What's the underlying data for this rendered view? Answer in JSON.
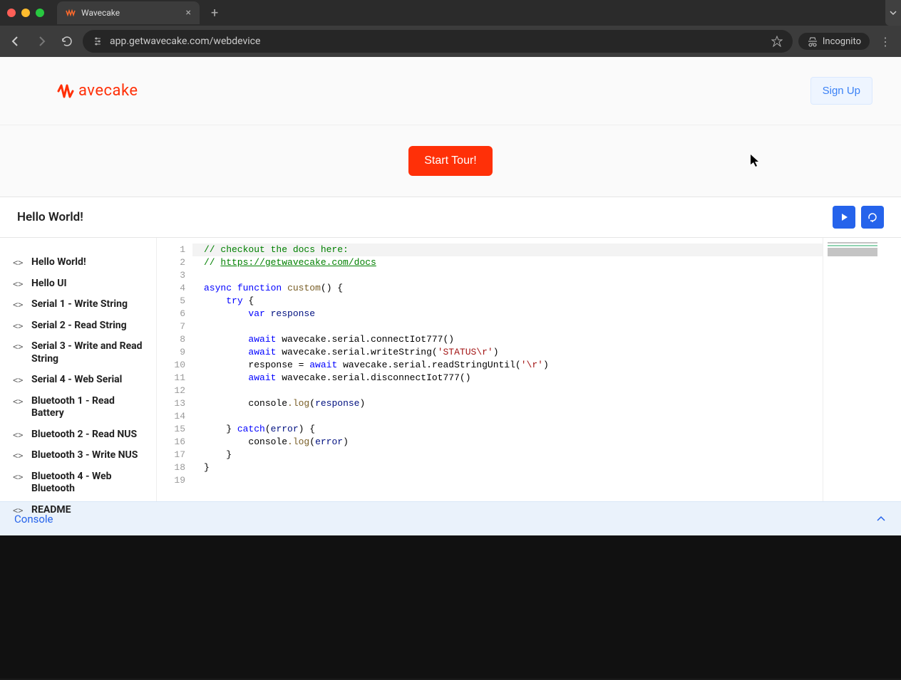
{
  "browser": {
    "tab_title": "Wavecake",
    "url": "app.getwavecake.com/webdevice",
    "incognito_label": "Incognito"
  },
  "header": {
    "logo_text": "avecake",
    "signup_label": "Sign Up"
  },
  "tour": {
    "button_label": "Start Tour!"
  },
  "titlebar": {
    "title": "Hello World!"
  },
  "sidebar": {
    "items": [
      {
        "label": "Hello World!"
      },
      {
        "label": "Hello UI"
      },
      {
        "label": "Serial 1 - Write String"
      },
      {
        "label": "Serial 2 - Read String"
      },
      {
        "label": "Serial 3 - Write and Read String"
      },
      {
        "label": "Serial 4 - Web Serial"
      },
      {
        "label": "Bluetooth 1 - Read Battery"
      },
      {
        "label": "Bluetooth 2 - Read NUS"
      },
      {
        "label": "Bluetooth 3 - Write NUS"
      },
      {
        "label": "Bluetooth 4 - Web Bluetooth"
      },
      {
        "label": "README"
      }
    ]
  },
  "editor": {
    "line_count": 19,
    "code": {
      "l1_comment": "// checkout the docs here:",
      "l2_prefix": "// ",
      "l2_link": "https://getwavecake.com/docs",
      "kw_async": "async",
      "kw_function": "function",
      "fn_custom": "custom",
      "open_paren": "(",
      "close_paren": ")",
      "open_brace": " {",
      "kw_try": "try",
      "brace": " {",
      "kw_var": "var",
      "name_response": " response",
      "kw_await": "await",
      "call_connect": " wavecake.serial.connectIot777",
      "parens": "()",
      "call_write": " wavecake.serial.writeString",
      "open_p": "(",
      "str_status": "'STATUS\\r'",
      "close_p": ")",
      "resp_eq": "response = ",
      "call_read": " wavecake.serial.readStringUntil",
      "str_cr": "'\\r'",
      "call_disc": " wavecake.serial.disconnectIot777",
      "console": "console",
      "log": ".log",
      "resp_arg": "response",
      "close_brace": "}",
      "kw_catch": " catch",
      "err": "error",
      "close_brace2": "}",
      "l1": "1",
      "l2": "2",
      "l3": "3",
      "l4": "4",
      "l5": "5",
      "l6": "6",
      "l7": "7",
      "l8": "8",
      "l9": "9",
      "l10": "10",
      "l11": "11",
      "l12": "12",
      "l13": "13",
      "l14": "14",
      "l15": "15",
      "l16": "16",
      "l17": "17",
      "l18": "18",
      "l19": "19"
    }
  },
  "console": {
    "label": "Console"
  }
}
